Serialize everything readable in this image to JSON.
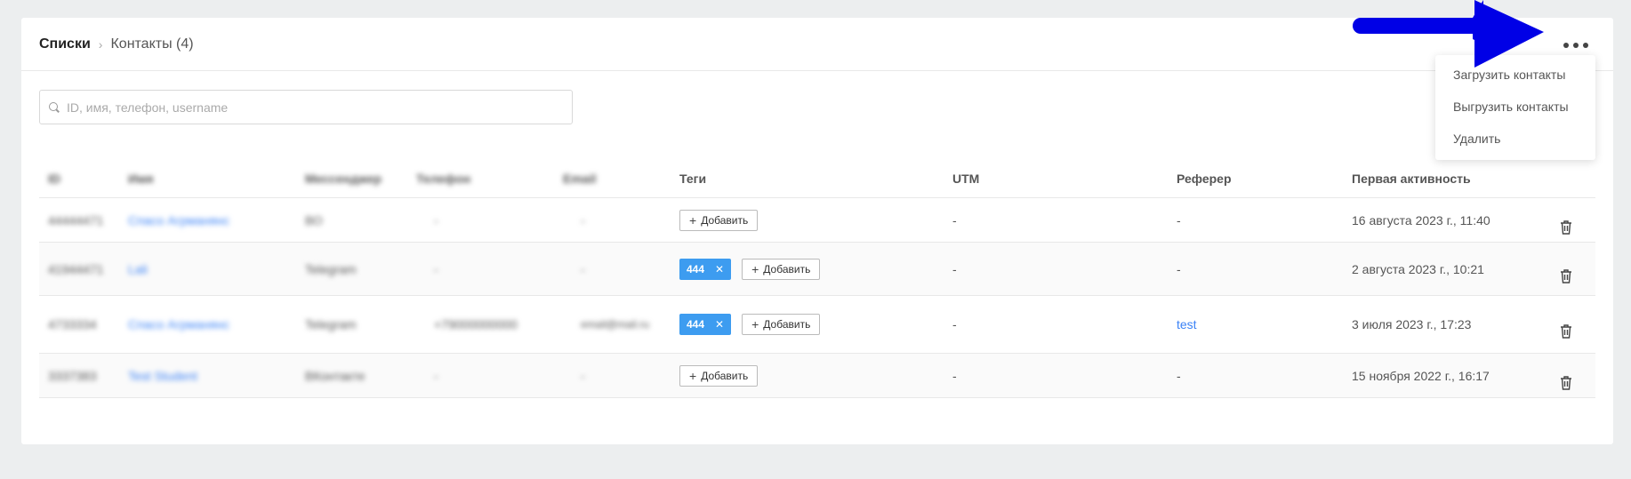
{
  "breadcrumb": {
    "root": "Списки",
    "separator": "›",
    "current": "Контакты (4)"
  },
  "search": {
    "placeholder": "ID, имя, телефон, username",
    "value": ""
  },
  "menu": {
    "items": [
      "Загрузить контакты",
      "Выгрузить контакты",
      "Удалить"
    ]
  },
  "table": {
    "headers": {
      "id": "ID",
      "name": "Имя",
      "messenger": "Мессенджер",
      "phone": "Телефон",
      "email": "Email",
      "tags": "Теги",
      "utm": "UTM",
      "referrer": "Реферер",
      "first_activity": "Первая активность"
    },
    "add_label": "Добавить",
    "rows": [
      {
        "id": "44444471",
        "name": "Спасо Агрманянс",
        "messenger": "ВО",
        "phone": "-",
        "email": "-",
        "tags": [],
        "utm": "-",
        "referrer": "-",
        "first_activity": "16 августа 2023 г., 11:40"
      },
      {
        "id": "41944471",
        "name": "Lali",
        "messenger": "Telegram",
        "phone": "-",
        "email": "-",
        "tags": [
          "444"
        ],
        "utm": "-",
        "referrer": "-",
        "first_activity": "2 августа 2023 г., 10:21"
      },
      {
        "id": "4733334",
        "name": "Спасо Агрманянс",
        "messenger": "Telegram",
        "phone": "+79000000000",
        "email": "email@mail.ru",
        "tags": [
          "444"
        ],
        "utm": "-",
        "referrer": "test",
        "first_activity": "3 июля 2023 г., 17:23"
      },
      {
        "id": "3337383",
        "name": "Test Student",
        "messenger": "ВКонтакте",
        "phone": "-",
        "email": "-",
        "tags": [],
        "utm": "-",
        "referrer": "-",
        "first_activity": "15 ноября 2022 г., 16:17"
      }
    ]
  },
  "colors": {
    "accent": "#3d9cf0",
    "arrow": "#0000e6",
    "link": "#3b82f6"
  }
}
